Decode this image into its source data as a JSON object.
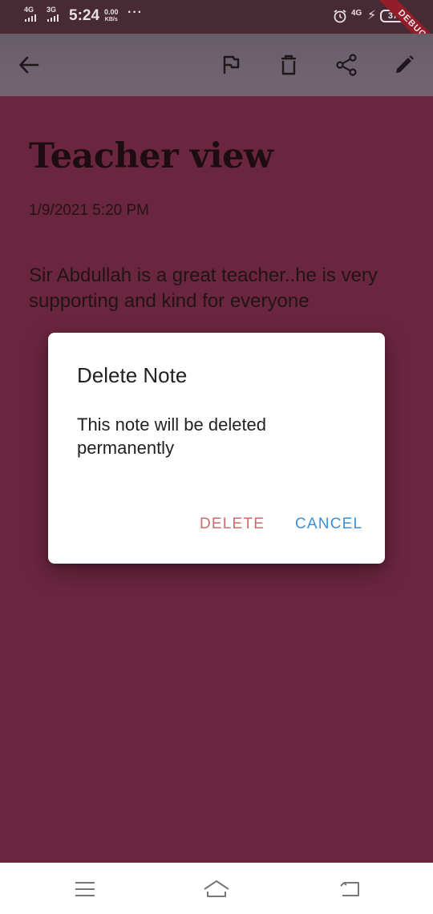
{
  "status_bar": {
    "network_1": "4G",
    "network_2": "3G",
    "time": "5:24",
    "speed_value": "0.00",
    "speed_unit": "KB/s",
    "more": "···",
    "network_3": "4G",
    "battery": "37",
    "debug_banner": "DEBUG"
  },
  "app_bar": {
    "icons": [
      "back-arrow-icon",
      "flag-icon",
      "delete-icon",
      "share-icon",
      "edit-icon"
    ]
  },
  "note": {
    "title": "Teacher view",
    "date": "1/9/2021 5:20 PM",
    "body": "Sir Abdullah is a great teacher..he is very supporting and kind for everyone",
    "background_color": "#722b45"
  },
  "dialog": {
    "title": "Delete Note",
    "message": "This note will be deleted permanently",
    "delete_label": "DELETE",
    "cancel_label": "CANCEL",
    "delete_color": "#d06b6b",
    "cancel_color": "#3d8fd6"
  },
  "nav_bar": {
    "icons": [
      "menu-icon",
      "home-icon",
      "back-icon"
    ]
  }
}
